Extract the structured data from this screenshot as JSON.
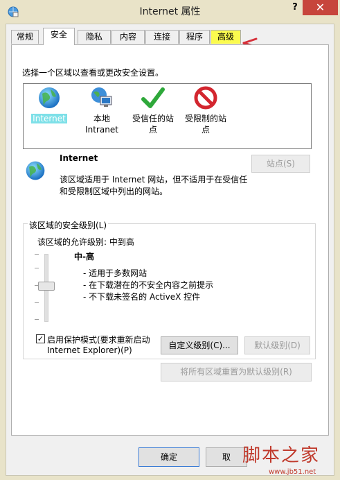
{
  "window": {
    "title": "Internet 属性",
    "help": "?",
    "close": "✕"
  },
  "tabs": [
    {
      "label": "常规"
    },
    {
      "label": "安全"
    },
    {
      "label": "隐私"
    },
    {
      "label": "内容"
    },
    {
      "label": "连接"
    },
    {
      "label": "程序"
    },
    {
      "label": "高级"
    }
  ],
  "security": {
    "instruction": "选择一个区域以查看或更改安全设置。",
    "zones": [
      {
        "line1": "Internet",
        "line2": "",
        "icon": "globe-icon",
        "selected": true
      },
      {
        "line1": "本地",
        "line2": "Intranet",
        "icon": "intranet-icon"
      },
      {
        "line1": "受信任的站",
        "line2": "点",
        "icon": "checkmark-icon"
      },
      {
        "line1": "受限制的站",
        "line2": "点",
        "icon": "restricted-icon"
      }
    ],
    "zone_name": "Internet",
    "zone_desc_line1": "该区域适用于 Internet 网站，但不适用于在受信任",
    "zone_desc_line2": "和受限制区域中列出的网站。",
    "sites_button": "站点(S)",
    "level_group_title": "该区域的安全级别(L)",
    "allowed_levels": "该区域的允许级别: 中到高",
    "level_name": "中-高",
    "level_desc": [
      "- 适用于多数网站",
      "- 在下载潜在的不安全内容之前提示",
      "- 不下载未签名的 ActiveX 控件"
    ],
    "protected_mode_line1": "启用保护模式(要求重新启动",
    "protected_mode_line2": "Internet Explorer)(P)",
    "protected_mode_checked": "✓",
    "custom_level_button": "自定义级别(C)...",
    "default_level_button": "默认级别(D)",
    "reset_all_button": "将所有区域重置为默认级别(R)"
  },
  "footer": {
    "ok_button": "确定",
    "cancel_button": "取"
  },
  "watermark": {
    "text": "脚本之家",
    "url": "www.jb51.net"
  }
}
